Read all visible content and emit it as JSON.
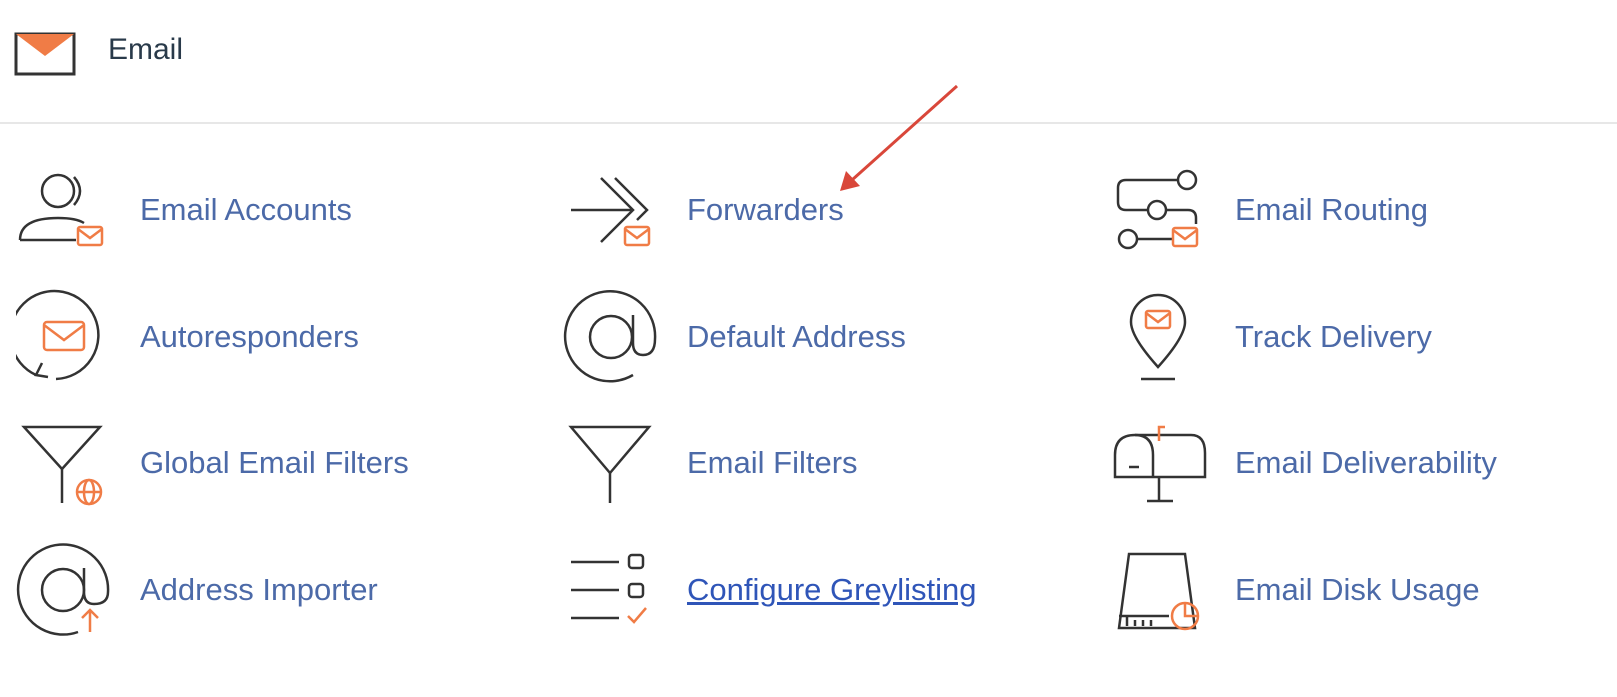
{
  "header": {
    "title": "Email",
    "icon": "envelope-icon"
  },
  "colors": {
    "link": "#4c6aa8",
    "accent": "#f07c46",
    "icon_stroke": "#333333",
    "annotation": "#d9473a"
  },
  "items": [
    {
      "label": "Email Accounts",
      "icon": "user-mail-icon"
    },
    {
      "label": "Forwarders",
      "icon": "forward-mail-icon"
    },
    {
      "label": "Email Routing",
      "icon": "routing-mail-icon"
    },
    {
      "label": "Autoresponders",
      "icon": "autoresponder-icon"
    },
    {
      "label": "Default Address",
      "icon": "at-sign-icon"
    },
    {
      "label": "Track Delivery",
      "icon": "map-pin-mail-icon"
    },
    {
      "label": "Global Email Filters",
      "icon": "funnel-globe-icon"
    },
    {
      "label": "Email Filters",
      "icon": "funnel-icon"
    },
    {
      "label": "Email Deliverability",
      "icon": "mailbox-icon"
    },
    {
      "label": "Address Importer",
      "icon": "at-upload-icon"
    },
    {
      "label": "Configure Greylisting",
      "icon": "checklist-icon"
    },
    {
      "label": "Email Disk Usage",
      "icon": "disk-usage-icon"
    }
  ]
}
